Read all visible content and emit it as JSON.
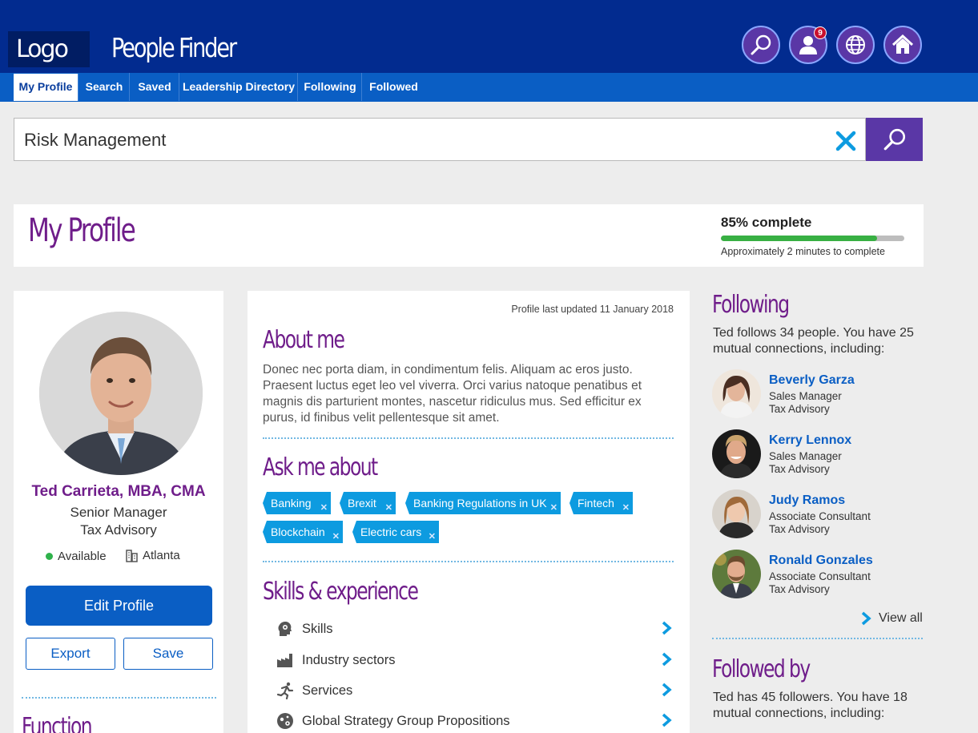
{
  "header": {
    "logo": "Logo",
    "app_title": "People Finder",
    "notification_count": "9",
    "icons": [
      "search-icon",
      "person-icon",
      "globe-icon",
      "home-icon"
    ]
  },
  "nav": {
    "tabs": [
      {
        "label": "My Profile",
        "active": true
      },
      {
        "label": "Search",
        "active": false
      },
      {
        "label": "Saved",
        "active": false
      },
      {
        "label": "Leadership Directory",
        "active": false
      },
      {
        "label": "Following",
        "active": false
      },
      {
        "label": "Followed",
        "active": false
      }
    ]
  },
  "search": {
    "value": "Risk Management"
  },
  "profile_header": {
    "title": "My Profile",
    "complete_label": "85% complete",
    "complete_fraction": 0.85,
    "complete_sub": "Approximately 2 minutes to complete"
  },
  "person": {
    "name": "Ted Carrieta, MBA, CMA",
    "role": "Senior Manager",
    "dept": "Tax Advisory",
    "status": "Available",
    "location": "Atlanta"
  },
  "actions": {
    "edit": "Edit Profile",
    "export": "Export",
    "save": "Save"
  },
  "left_section": {
    "title": "Function"
  },
  "middle": {
    "updated": "Profile last updated 11 January 2018",
    "about_title": "About me",
    "about_text": "Donec nec porta diam, in condimentum felis. Aliquam ac eros justo. Praesent luctus eget leo vel viverra. Orci varius natoque penatibus et magnis dis parturient montes, nascetur ridiculus mus. Sed efficitur ex purus, id finibus velit pellentesque sit amet.",
    "ask_title": "Ask me about",
    "tags": [
      "Banking",
      "Brexit",
      "Banking Regulations in UK",
      "Fintech",
      "Blockchain",
      "Electric cars"
    ],
    "skills_title": "Skills & experience",
    "skills": [
      {
        "label": "Skills",
        "icon": "head-gear-icon"
      },
      {
        "label": "Industry sectors",
        "icon": "factory-icon"
      },
      {
        "label": "Services",
        "icon": "runner-icon"
      },
      {
        "label": "Global Strategy Group Propositions",
        "icon": "globe-gear-icon"
      }
    ]
  },
  "following": {
    "title": "Following",
    "summary": "Ted follows 34 people. You have 25 mutual connections, including:",
    "people": [
      {
        "name": "Beverly Garza",
        "title": "Sales Manager",
        "dept": "Tax Advisory"
      },
      {
        "name": "Kerry Lennox",
        "title": "Sales Manager",
        "dept": "Tax Advisory"
      },
      {
        "name": "Judy Ramos",
        "title": "Associate Consultant",
        "dept": "Tax Advisory"
      },
      {
        "name": "Ronald Gonzales",
        "title": "Associate Consultant",
        "dept": "Tax Advisory"
      }
    ],
    "view_all": "View all"
  },
  "followed_by": {
    "title": "Followed by",
    "summary": "Ted has 45 followers. You have 18 mutual connections, including:"
  },
  "colors": {
    "header_bg": "#022b8f",
    "nav_bg": "#0a5ec4",
    "accent_purple": "#6f1d8a",
    "button_purple": "#5a37a6",
    "tag_blue": "#0d9be0",
    "progress_green": "#38b043",
    "status_green": "#2fb24b"
  }
}
